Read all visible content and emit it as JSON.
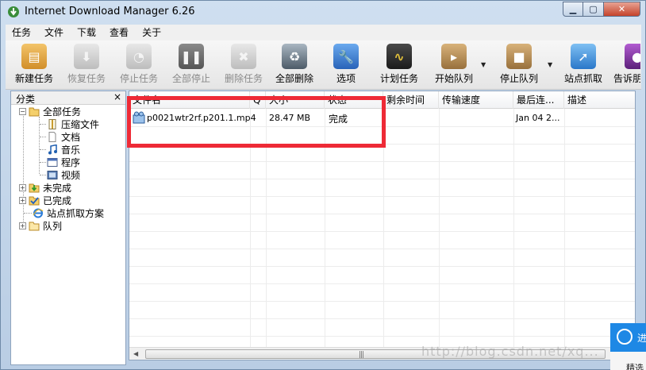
{
  "window": {
    "title": "Internet Download Manager 6.26"
  },
  "menu": [
    "任务",
    "文件",
    "下载",
    "查看",
    "关于"
  ],
  "toolbar": [
    {
      "label": "新建任务",
      "icon": "new-task-icon",
      "disabled": false,
      "color": "#e3a53c"
    },
    {
      "label": "恢复任务",
      "icon": "resume-icon",
      "disabled": true,
      "color": "#c8c8c8"
    },
    {
      "label": "停止任务",
      "icon": "stop-task-icon",
      "disabled": true,
      "color": "#c8c8c8"
    },
    {
      "label": "全部停止",
      "icon": "stop-all-icon",
      "disabled": true,
      "color": "#c8c8c8"
    },
    {
      "label": "删除任务",
      "icon": "delete-task-icon",
      "disabled": true,
      "color": "#c8c8c8"
    },
    {
      "label": "全部删除",
      "icon": "delete-all-icon",
      "disabled": false,
      "color": "#5b6d7d"
    },
    {
      "label": "选项",
      "icon": "wrench-icon",
      "disabled": false,
      "color": "#3d7ed6"
    },
    {
      "label": "计划任务",
      "icon": "scheduler-icon",
      "disabled": false,
      "color": "#3a3a3a"
    },
    {
      "label": "开始队列",
      "icon": "start-queue-icon",
      "disabled": false,
      "color": "#b0884f"
    },
    {
      "label": "停止队列",
      "icon": "stop-queue-icon",
      "disabled": false,
      "color": "#b0884f"
    },
    {
      "label": "站点抓取",
      "icon": "site-grabber-icon",
      "disabled": false,
      "color": "#2f86d8"
    },
    {
      "label": "告诉朋友",
      "icon": "tell-friend-icon",
      "disabled": false,
      "color": "#7b3aa0"
    }
  ],
  "categories": {
    "header": "分类",
    "close": "×",
    "nodes": [
      {
        "label": "全部任务",
        "icon": "folder-open-icon",
        "expander": "−"
      },
      {
        "label": "压缩文件",
        "icon": "archive-icon"
      },
      {
        "label": "文档",
        "icon": "document-icon"
      },
      {
        "label": "音乐",
        "icon": "music-icon"
      },
      {
        "label": "程序",
        "icon": "program-icon"
      },
      {
        "label": "视频",
        "icon": "video-icon"
      },
      {
        "label": "未完成",
        "icon": "unfinished-folder-icon",
        "expander": "+"
      },
      {
        "label": "已完成",
        "icon": "finished-folder-icon",
        "expander": "+"
      },
      {
        "label": "站点抓取方案",
        "icon": "ie-icon"
      },
      {
        "label": "队列",
        "icon": "queue-folder-icon",
        "expander": "+"
      }
    ]
  },
  "list": {
    "columns": [
      "文件名",
      "Q",
      "大小",
      "状态",
      "剩余时间",
      "传输速度",
      "最后连...",
      "描述"
    ],
    "rows": [
      {
        "filename": "p0021wtr2rf.p201.1.mp4",
        "q": "",
        "size": "28.47 MB",
        "status": "完成",
        "time_left": "",
        "speed": "",
        "last_try": "Jan 04 2...",
        "description": ""
      }
    ]
  },
  "watermark": "http://blog.csdn.net/xq... ",
  "overlay": {
    "button_text": "进",
    "strip_text": "精选"
  }
}
